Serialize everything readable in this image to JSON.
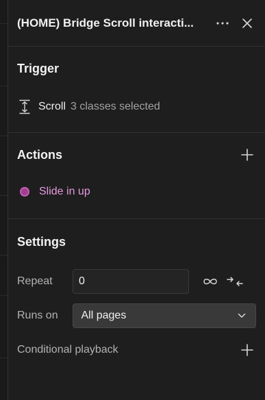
{
  "header": {
    "title": "(HOME) Bridge Scroll interacti...",
    "more_icon": "more-horizontal-icon",
    "close_icon": "close-icon"
  },
  "trigger": {
    "heading": "Trigger",
    "icon": "scroll-vertical-icon",
    "name": "Scroll",
    "selection": "3 classes selected"
  },
  "actions": {
    "heading": "Actions",
    "add_icon": "plus-icon",
    "items": [
      {
        "label": "Slide in up",
        "color": "#9e3f90"
      }
    ]
  },
  "settings": {
    "heading": "Settings",
    "repeat_label": "Repeat",
    "repeat_value": "0",
    "infinite_icon": "infinity-icon",
    "collapse_icon": "arrows-collapse-icon",
    "runs_on_label": "Runs on",
    "runs_on_value": "All pages",
    "conditional_label": "Conditional playback",
    "conditional_add_icon": "plus-icon"
  }
}
